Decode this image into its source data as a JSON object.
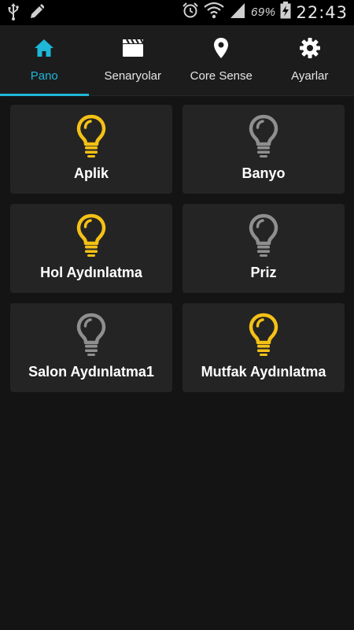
{
  "status_bar": {
    "left_icons": [
      "usb-icon",
      "pencil-icon"
    ],
    "right_icons": [
      "alarm-icon",
      "wifi-icon",
      "signal-icon",
      "battery-charging-icon"
    ],
    "battery_percent": "69%",
    "time": "22:43"
  },
  "nav": {
    "tabs": [
      {
        "label": "Pano",
        "icon": "home-icon",
        "active": true
      },
      {
        "label": "Senaryolar",
        "icon": "clapperboard-icon",
        "active": false
      },
      {
        "label": "Core Sense",
        "icon": "location-pin-icon",
        "active": false
      },
      {
        "label": "Ayarlar",
        "icon": "gear-icon",
        "active": false
      }
    ]
  },
  "devices": [
    {
      "label": "Aplik",
      "state": "on"
    },
    {
      "label": "Banyo",
      "state": "off"
    },
    {
      "label": "Hol Aydınlatma",
      "state": "on"
    },
    {
      "label": "Priz",
      "state": "off"
    },
    {
      "label": "Salon Aydınlatma1",
      "state": "off"
    },
    {
      "label": "Mutfak Aydınlatma",
      "state": "on"
    }
  ],
  "colors": {
    "accent": "#1fb7d8",
    "bulb_on": "#f5c116",
    "bulb_off": "#8f8f8f",
    "card_bg": "#242424",
    "page_bg": "#141414"
  }
}
